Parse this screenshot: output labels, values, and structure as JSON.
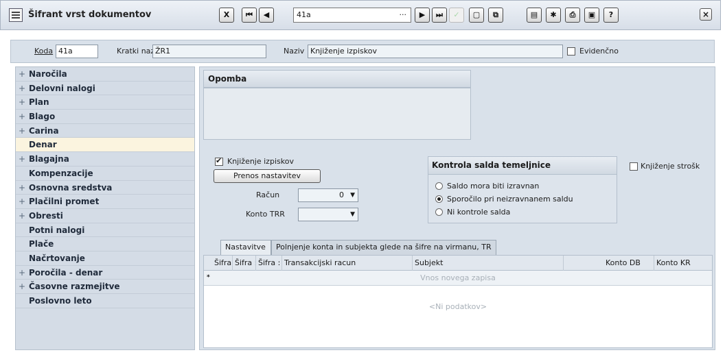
{
  "window": {
    "title": "Šifrant vrst dokumentov",
    "nav_value": "41a",
    "nav_dots": "···"
  },
  "toolbar": {
    "first": "⏮",
    "prev": "◀",
    "next": "▶",
    "last": "⏭",
    "confirm": "✓",
    "close": "×"
  },
  "header": {
    "koda_label": "Koda",
    "koda_value": "41a",
    "kratki_label": "Kratki naziv",
    "kratki_value": "ŽR1",
    "naziv_label": "Naziv",
    "naziv_value": "Knjiženje izpiskov",
    "evidencno_label": "Evidenčno",
    "evidencno_checked": false
  },
  "sidebar": {
    "items": [
      {
        "label": "Naročila",
        "expandable": true
      },
      {
        "label": "Delovni nalogi",
        "expandable": true
      },
      {
        "label": "Plan",
        "expandable": true
      },
      {
        "label": "Blago",
        "expandable": true
      },
      {
        "label": "Carina",
        "expandable": true
      },
      {
        "label": "Denar",
        "expandable": false,
        "active": true
      },
      {
        "label": "Blagajna",
        "expandable": true
      },
      {
        "label": "Kompenzacije",
        "expandable": false
      },
      {
        "label": "Osnovna sredstva",
        "expandable": true
      },
      {
        "label": "Plačilni promet",
        "expandable": true
      },
      {
        "label": "Obresti",
        "expandable": true
      },
      {
        "label": "Potni nalogi",
        "expandable": false
      },
      {
        "label": "Plače",
        "expandable": false
      },
      {
        "label": "Načrtovanje",
        "expandable": false
      },
      {
        "label": "Poročila - denar",
        "expandable": true
      },
      {
        "label": "Časovne razmejitve",
        "expandable": true
      },
      {
        "label": "Poslovno leto",
        "expandable": false
      }
    ],
    "plus": "+"
  },
  "main": {
    "opomba_title": "Opomba",
    "knjizenje_izpiskov_label": "Knjiženje izpiskov",
    "knjizenje_izpiskov_checked": true,
    "prenos_button": "Prenos nastavitev",
    "racun_label": "Račun",
    "racun_value": "0",
    "konto_trr_label": "Konto TRR",
    "konto_trr_value": "",
    "kontrola_title": "Kontrola salda temeljnice",
    "radios": [
      {
        "label": "Saldo mora biti izravnan",
        "selected": false
      },
      {
        "label": "Sporočilo pri neizravnanem saldu",
        "selected": true
      },
      {
        "label": "Ni kontrole salda",
        "selected": false
      }
    ],
    "knjizenje_stroskov_label": "Knjiženje strošk",
    "knjizenje_stroskov_checked": false,
    "tabs": [
      {
        "label": "Nastavitve",
        "active": true
      },
      {
        "label": "Polnjenje konta in subjekta glede na šifre na virmanu, TR",
        "active": false
      }
    ],
    "grid": {
      "columns": [
        "Šifra",
        "Šifra :",
        "Šifra :",
        "Transakcijski racun",
        "Subjekt",
        "Konto DB",
        "Konto KR"
      ],
      "new_row_marker": "*",
      "new_row_text": "Vnos novega zapisa",
      "empty_text": "<Ni podatkov>"
    }
  }
}
